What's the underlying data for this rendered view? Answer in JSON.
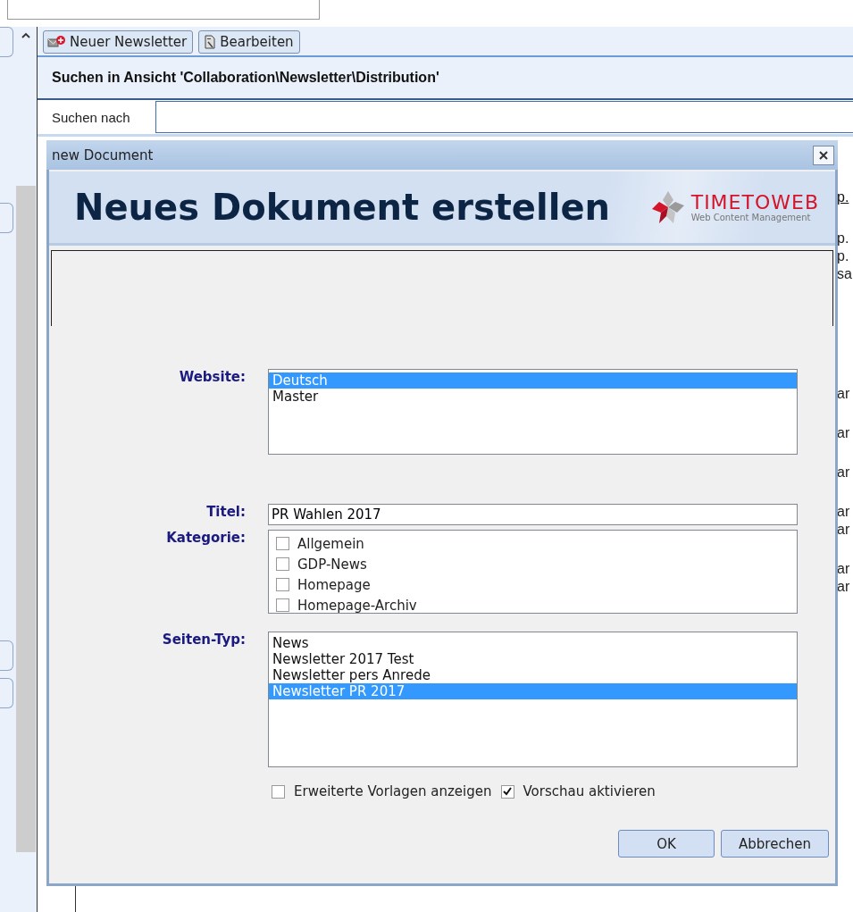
{
  "toolbar": {
    "buttons": [
      {
        "label": "Neuer Newsletter",
        "kind": "new"
      },
      {
        "label": "Bearbeiten",
        "kind": "edit"
      }
    ]
  },
  "search": {
    "heading": "Suchen in Ansicht 'Collaboration\\Newsletter\\Distribution'",
    "label": "Suchen nach"
  },
  "background_fragments": [
    {
      "text": "p.",
      "kind": "link"
    },
    {
      "text": "p.",
      "kind": "text"
    },
    {
      "text": "p.",
      "kind": "text"
    },
    {
      "text": "sa",
      "kind": "text"
    },
    {
      "text": "ar",
      "kind": "text"
    },
    {
      "text": "ar",
      "kind": "text"
    },
    {
      "text": "ar",
      "kind": "text"
    },
    {
      "text": "ar",
      "kind": "text"
    },
    {
      "text": "ar",
      "kind": "text"
    },
    {
      "text": "ar",
      "kind": "text"
    },
    {
      "text": "ar",
      "kind": "text"
    }
  ],
  "dialog": {
    "title": "new Document",
    "banner": {
      "heading": "Neues Dokument erstellen",
      "logo_name": "TIMETOWEB",
      "logo_tagline": "Web Content Management"
    },
    "website": {
      "label": "Website:",
      "options": [
        {
          "label": "Deutsch",
          "selected": true
        },
        {
          "label": "Master",
          "selected": false
        }
      ]
    },
    "titel": {
      "label": "Titel:",
      "value": "PR Wahlen 2017"
    },
    "kategorie": {
      "label": "Kategorie:",
      "options": [
        {
          "label": "Allgemein",
          "checked": false
        },
        {
          "label": "GDP-News",
          "checked": false
        },
        {
          "label": "Homepage",
          "checked": false
        },
        {
          "label": "Homepage-Archiv",
          "checked": false
        }
      ]
    },
    "seiten_typ": {
      "label": "Seiten-Typ:",
      "options": [
        {
          "label": "News",
          "selected": false
        },
        {
          "label": "Newsletter 2017 Test",
          "selected": false
        },
        {
          "label": "Newsletter pers Anrede",
          "selected": false
        },
        {
          "label": "Newsletter PR 2017",
          "selected": true
        }
      ]
    },
    "options": [
      {
        "label": "Erweiterte Vorlagen anzeigen",
        "checked": false
      },
      {
        "label": "Vorschau aktivieren",
        "checked": true
      }
    ],
    "buttons": [
      {
        "label": "OK"
      },
      {
        "label": "Abbrechen"
      }
    ]
  }
}
